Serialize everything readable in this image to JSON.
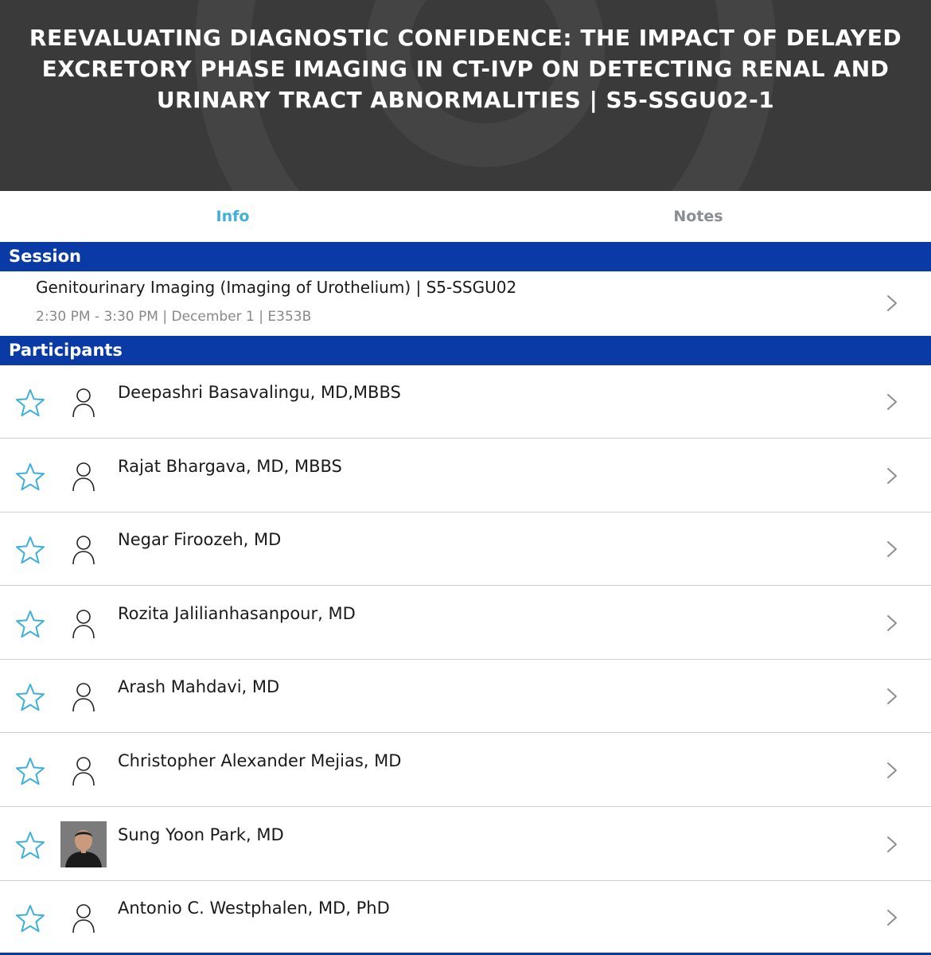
{
  "header": {
    "title": "REEVALUATING DIAGNOSTIC CONFIDENCE: THE IMPACT OF DELAYED EXCRETORY PHASE IMAGING IN CT-IVP ON DETECTING RENAL AND URINARY TRACT ABNORMALITIES | S5-SSGU02-1"
  },
  "tabs": [
    {
      "label": "Info",
      "active": true
    },
    {
      "label": "Notes",
      "active": false
    }
  ],
  "session": {
    "header": "Session",
    "title": "Genitourinary Imaging (Imaging of Urothelium) | S5-SSGU02",
    "meta": "2:30 PM - 3:30 PM | December 1 | E353B"
  },
  "participants": {
    "header": "Participants",
    "items": [
      {
        "name": "Deepashri Basavalingu, MD,MBBS",
        "avatar": "person-icon"
      },
      {
        "name": "Rajat Bhargava, MD, MBBS",
        "avatar": "person-icon"
      },
      {
        "name": "Negar Firoozeh, MD",
        "avatar": "person-icon"
      },
      {
        "name": "Rozita Jalilianhasanpour, MD",
        "avatar": "person-icon"
      },
      {
        "name": "Arash Mahdavi, MD",
        "avatar": "person-icon"
      },
      {
        "name": "Christopher Alexander Mejias, MD",
        "avatar": "person-icon"
      },
      {
        "name": "Sung Yoon Park, MD",
        "avatar": "photo"
      },
      {
        "name": "Antonio C. Westphalen, MD, PhD",
        "avatar": "person-icon"
      }
    ]
  },
  "colors": {
    "hero_bg": "#3a3a3b",
    "section_header_bg": "#0a3aa6",
    "active_tab": "#3fb0db",
    "inactive_tab": "#8a8d91",
    "star": "#3fb0db"
  }
}
